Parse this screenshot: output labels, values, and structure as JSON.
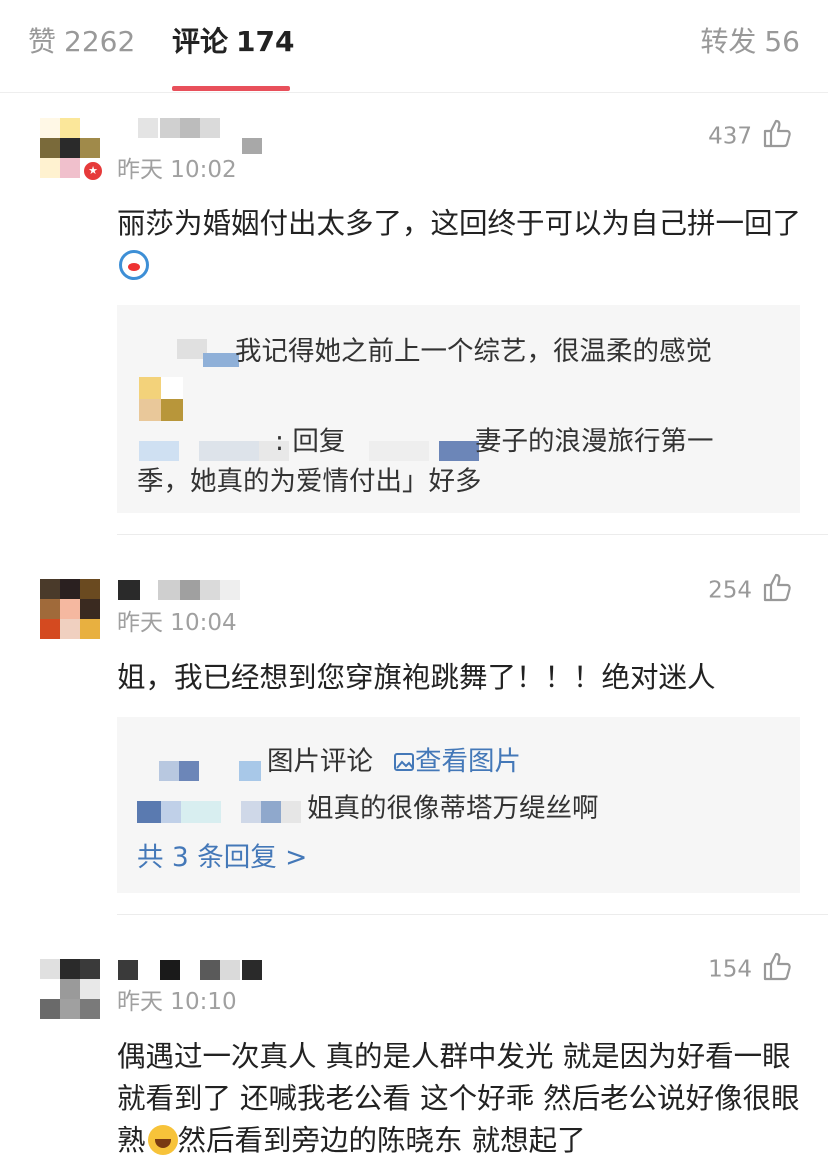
{
  "tabs": {
    "likes": {
      "label": "赞",
      "count": "2262"
    },
    "comments": {
      "label": "评论",
      "count": "174"
    },
    "reposts": {
      "label": "转发",
      "count": "56"
    }
  },
  "comments": [
    {
      "time": "昨天 10:02",
      "likes": "437",
      "text": "丽莎为婚姻付出太多了，这回终于可以为自己拼一回了",
      "emoji": "doraemon-emoji",
      "replies": [
        {
          "text": "我记得她之前上一个综艺，很温柔的感觉"
        },
        {
          "prefix": ": 回复",
          "text_line1": "妻子的浪漫旅行第一",
          "text_line2": "季，她真的为爱情付出」好多"
        }
      ]
    },
    {
      "time": "昨天 10:04",
      "likes": "254",
      "text": "姐，我已经想到您穿旗袍跳舞了！！！绝对迷人",
      "replies": [
        {
          "label": "图片评论",
          "view_image": "查看图片"
        },
        {
          "text": "姐真的很像蒂塔万缇丝啊"
        }
      ],
      "more_replies": "共 3 条回复 >"
    },
    {
      "time": "昨天 10:10",
      "likes": "154",
      "text": "偶遇过一次真人 真的是人群中发光 就是因为好看一眼就看到了 还喊我老公看 这个好乖 然后老公说好像很眼熟",
      "emoji": "laughing-tears-emoji",
      "text_after_emoji": "然后看到旁边的陈晓东 就想起了"
    }
  ],
  "colors": {
    "accent": "#e8505b",
    "link": "#4478b8",
    "muted": "#a0a0a0"
  }
}
